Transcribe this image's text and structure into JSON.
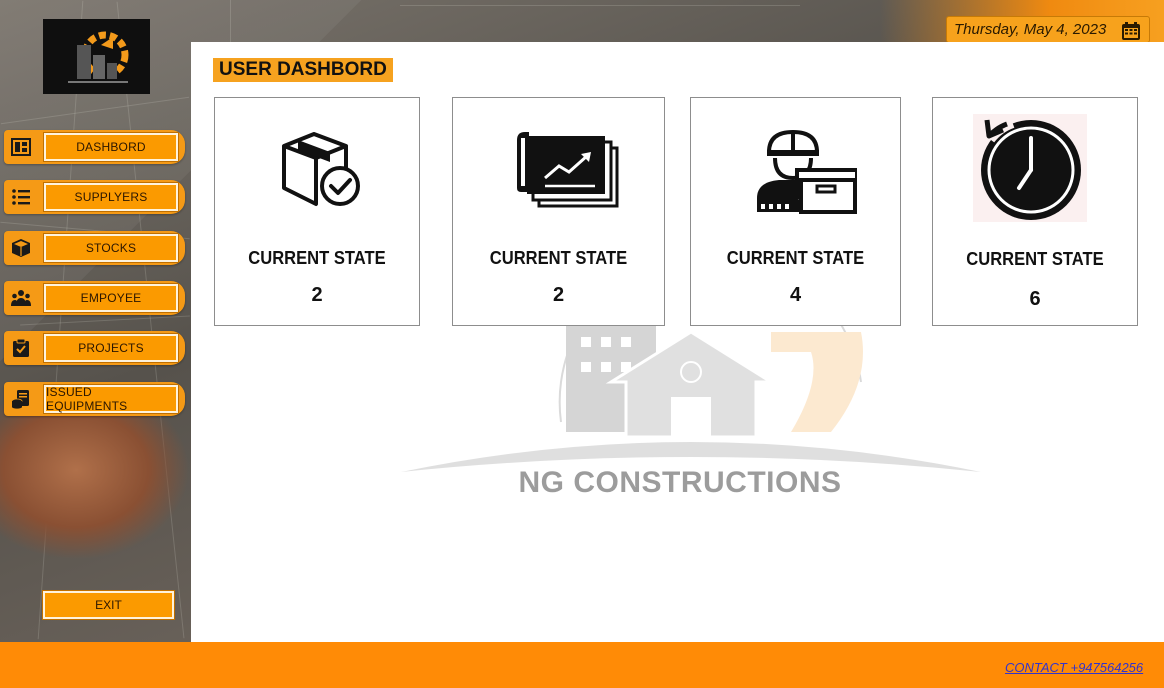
{
  "header": {
    "date": "Thursday, May 4, 2023",
    "calendar_icon": "calendar-icon",
    "accent_color": "#ff8b06"
  },
  "logo": {
    "icon": "gear-building-logo"
  },
  "sidebar": {
    "items": [
      {
        "label": "DASHBORD",
        "icon": "dashboard-icon"
      },
      {
        "label": "SUPPLYERS",
        "icon": "list-icon"
      },
      {
        "label": "STOCKS",
        "icon": "cube-icon"
      },
      {
        "label": "EMPOYEE",
        "icon": "people-icon"
      },
      {
        "label": "PROJECTS",
        "icon": "clipboard-icon"
      },
      {
        "label": "ISSUED EQUIPMENTS",
        "icon": "database-icon"
      }
    ],
    "exit_label": "EXIT"
  },
  "main": {
    "title": "USER DASHBORD",
    "cards": [
      {
        "label": "CURRENT STATE",
        "value": "2",
        "icon": "box-check-icon"
      },
      {
        "label": "CURRENT STATE",
        "value": "2",
        "icon": "blueprint-chart-icon"
      },
      {
        "label": "CURRENT STATE",
        "value": "4",
        "icon": "worker-box-icon"
      },
      {
        "label": "CURRENT STATE",
        "value": "6",
        "icon": "clock-icon"
      }
    ],
    "watermark_text": "NG CONSTRUCTIONS"
  },
  "footer": {
    "contact": "CONTACT  +947564256"
  }
}
